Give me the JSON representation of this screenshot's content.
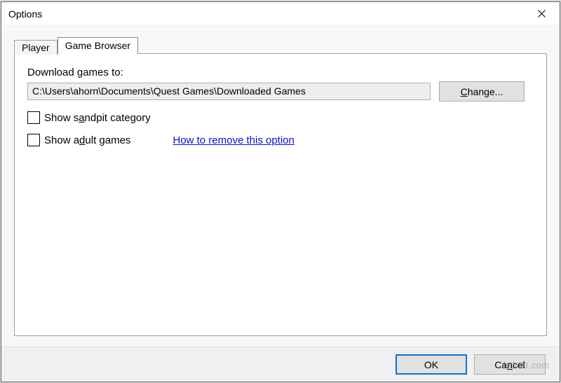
{
  "dialog": {
    "title": "Options"
  },
  "tabs": {
    "player": "Player",
    "game_browser": "Game Browser"
  },
  "panel": {
    "download_label": "Download games to:",
    "download_path": "C:\\Users\\ahorn\\Documents\\Quest Games\\Downloaded Games",
    "change_button_pre": "",
    "change_button_u": "C",
    "change_button_post": "hange...",
    "sandpit_pre": "Show s",
    "sandpit_u": "a",
    "sandpit_post": "ndpit category",
    "adult_pre": "Show a",
    "adult_u": "d",
    "adult_post": "ult games",
    "remove_link": "How to remove this option"
  },
  "buttons": {
    "ok": "OK",
    "cancel_pre": "Ca",
    "cancel_u": "n",
    "cancel_post": "cel"
  },
  "watermark": "LO4D.com"
}
